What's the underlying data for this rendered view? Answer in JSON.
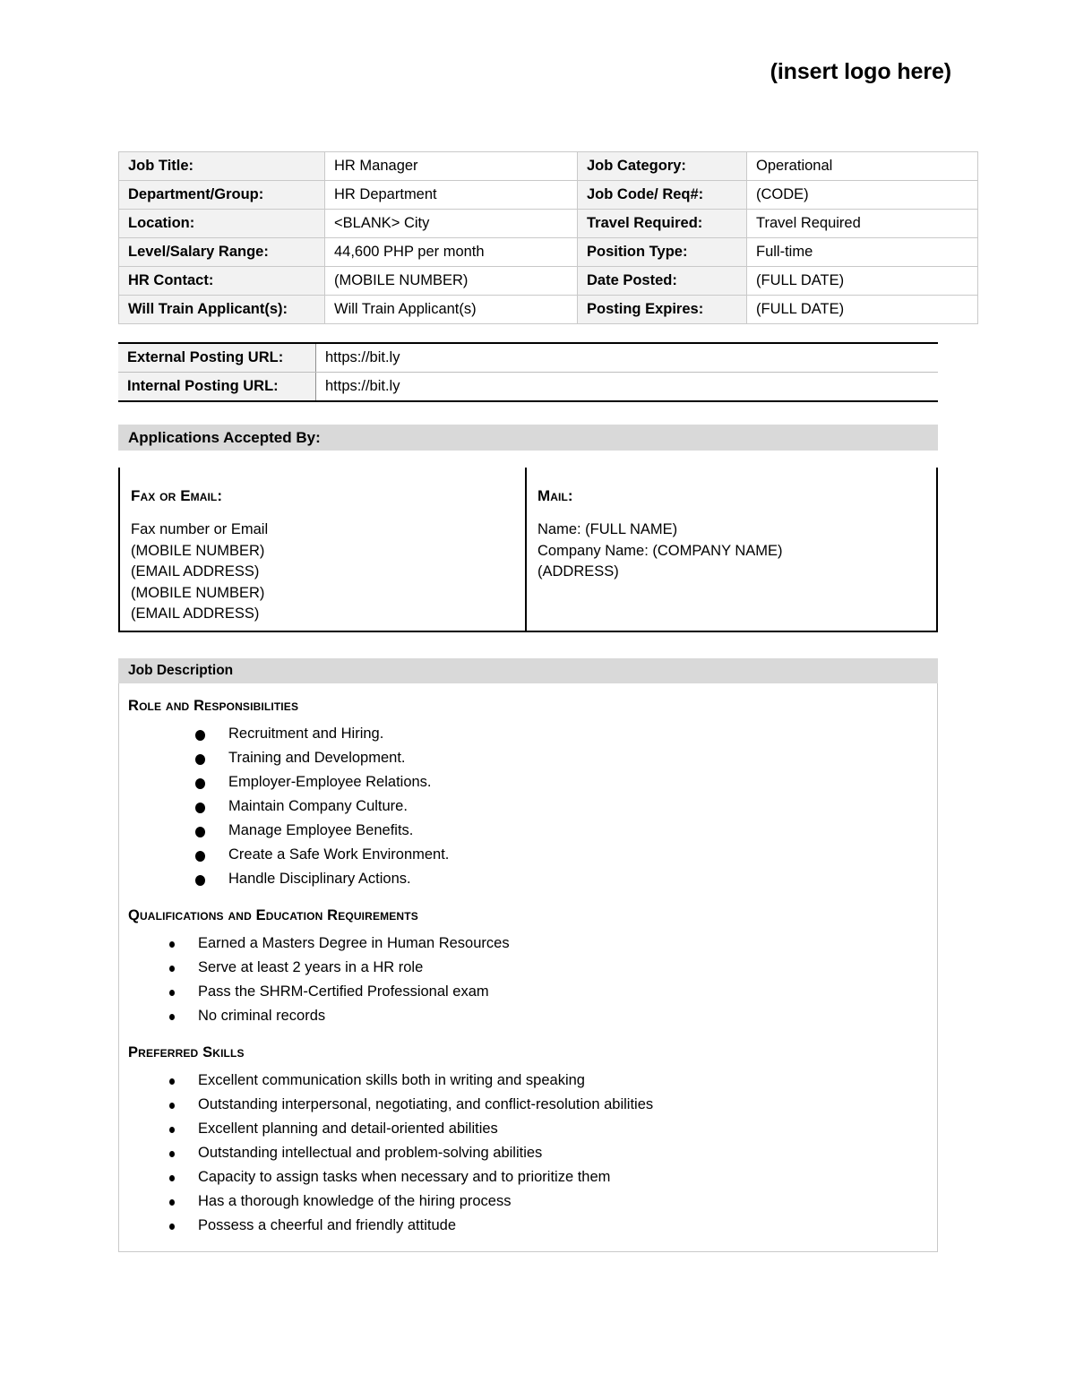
{
  "header": {
    "logo_placeholder": "(insert logo here)"
  },
  "info_table": {
    "rows": [
      {
        "label_left": "Job Title:",
        "value_left": "HR Manager",
        "label_right": "Job Category:",
        "value_right": "Operational"
      },
      {
        "label_left": "Department/Group:",
        "value_left": "HR Department",
        "label_right": "Job Code/ Req#:",
        "value_right": "(CODE)"
      },
      {
        "label_left": "Location:",
        "value_left": "<BLANK> City",
        "label_right": "Travel Required:",
        "value_right": "Travel Required"
      },
      {
        "label_left": "Level/Salary Range:",
        "value_left": "44,600 PHP per month",
        "label_right": "Position Type:",
        "value_right": "Full-time"
      },
      {
        "label_left": "HR Contact:",
        "value_left": "(MOBILE NUMBER)",
        "label_right": "Date Posted:",
        "value_right": "(FULL DATE)"
      },
      {
        "label_left": "Will Train Applicant(s):",
        "value_left": "Will Train Applicant(s)",
        "label_right": "Posting Expires:",
        "value_right": "(FULL DATE)"
      }
    ]
  },
  "url_table": {
    "rows": [
      {
        "label": "External Posting URL:",
        "value": "https://bit.ly"
      },
      {
        "label": "Internal Posting URL:",
        "value": "https://bit.ly"
      }
    ]
  },
  "applications": {
    "bar_title": "Applications Accepted By:",
    "fax_email": {
      "heading": "Fax or Email:",
      "lines": [
        "Fax number or Email",
        "(MOBILE NUMBER)",
        "(EMAIL ADDRESS)",
        "(MOBILE NUMBER)",
        "(EMAIL ADDRESS)"
      ]
    },
    "mail": {
      "heading": "Mail:",
      "lines": [
        "Name: (FULL NAME)",
        "Company Name: (COMPANY NAME)",
        "(ADDRESS)"
      ]
    }
  },
  "job_description": {
    "bar_title": "Job Description",
    "role_and_responsibilities": {
      "heading": "Role and Responsibilities",
      "items": [
        "Recruitment and Hiring.",
        "Training and Development.",
        "Employer-Employee Relations.",
        "Maintain Company Culture.",
        "Manage Employee Benefits.",
        "Create a Safe Work Environment.",
        "Handle Disciplinary Actions."
      ]
    },
    "qualifications": {
      "heading": "Qualifications and Education Requirements",
      "items": [
        "Earned a Masters Degree in Human Resources",
        "Serve at least 2 years in a HR role",
        "Pass the SHRM-Certified Professional exam",
        "No criminal records"
      ]
    },
    "preferred_skills": {
      "heading": "Preferred Skills",
      "items": [
        "Excellent communication skills both in writing and speaking",
        "Outstanding interpersonal, negotiating, and conflict-resolution abilities",
        "Excellent planning and detail-oriented abilities",
        "Outstanding intellectual and problem-solving abilities",
        "Capacity to assign tasks when necessary and to prioritize them",
        "Has a thorough knowledge of the hiring process",
        "Possess a cheerful and friendly attitude"
      ]
    }
  },
  "colors": {
    "bar_gray": "#d9d9d9",
    "cell_label_gray": "#f2f2f2",
    "cell_border": "#c9c9c9",
    "heavy_border": "#000000"
  }
}
